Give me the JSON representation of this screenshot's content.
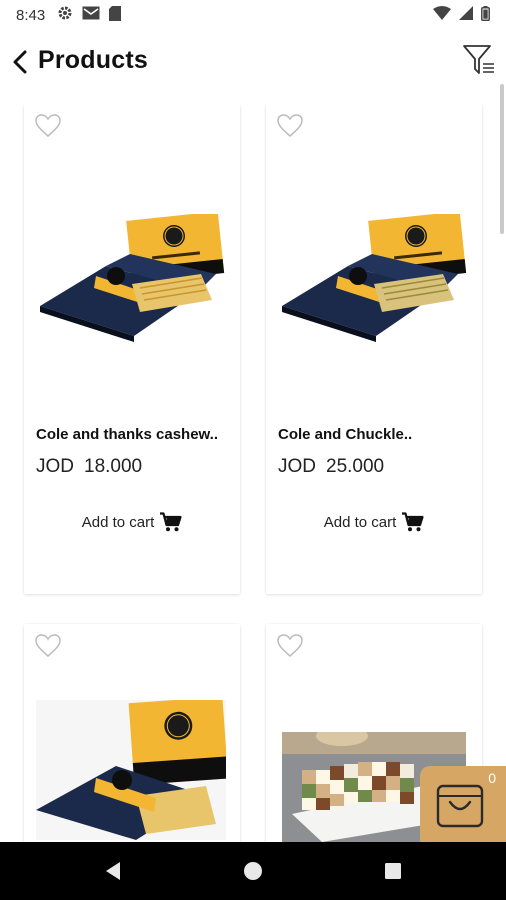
{
  "status_bar": {
    "time": "8:43",
    "left_icons": [
      "settings-icon",
      "gmail-icon",
      "sd-card-icon"
    ],
    "right_icons": [
      "wifi-icon",
      "signal-icon",
      "battery-icon"
    ]
  },
  "header": {
    "title": "Products",
    "back_icon": "chevron-left-icon",
    "filter_icon": "filter-icon"
  },
  "products": [
    {
      "name": "Cole and thanks cashew..",
      "currency": "JOD",
      "price": "18.000",
      "add_to_cart": "Add to cart",
      "favorite": false,
      "image": "gold-sweets-box-image"
    },
    {
      "name": "Cole and Chuckle..",
      "currency": "JOD",
      "price": "25.000",
      "add_to_cart": "Add to cart",
      "favorite": false,
      "image": "gold-sweets-box-image"
    },
    {
      "name": "",
      "currency": "",
      "price": "",
      "add_to_cart": "",
      "favorite": false,
      "image": "gold-sweets-box-image"
    },
    {
      "name": "",
      "currency": "",
      "price": "",
      "add_to_cart": "",
      "favorite": false,
      "image": "checkered-cake-image"
    }
  ],
  "cart": {
    "count": "0",
    "icon": "shopping-bag-icon"
  },
  "nav_bar": {
    "buttons": [
      "back-triangle-icon",
      "home-circle-icon",
      "recents-square-icon"
    ]
  },
  "colors": {
    "accent": "#d6a764",
    "box_gold": "#f2b632",
    "box_navy": "#1b2a4a"
  }
}
